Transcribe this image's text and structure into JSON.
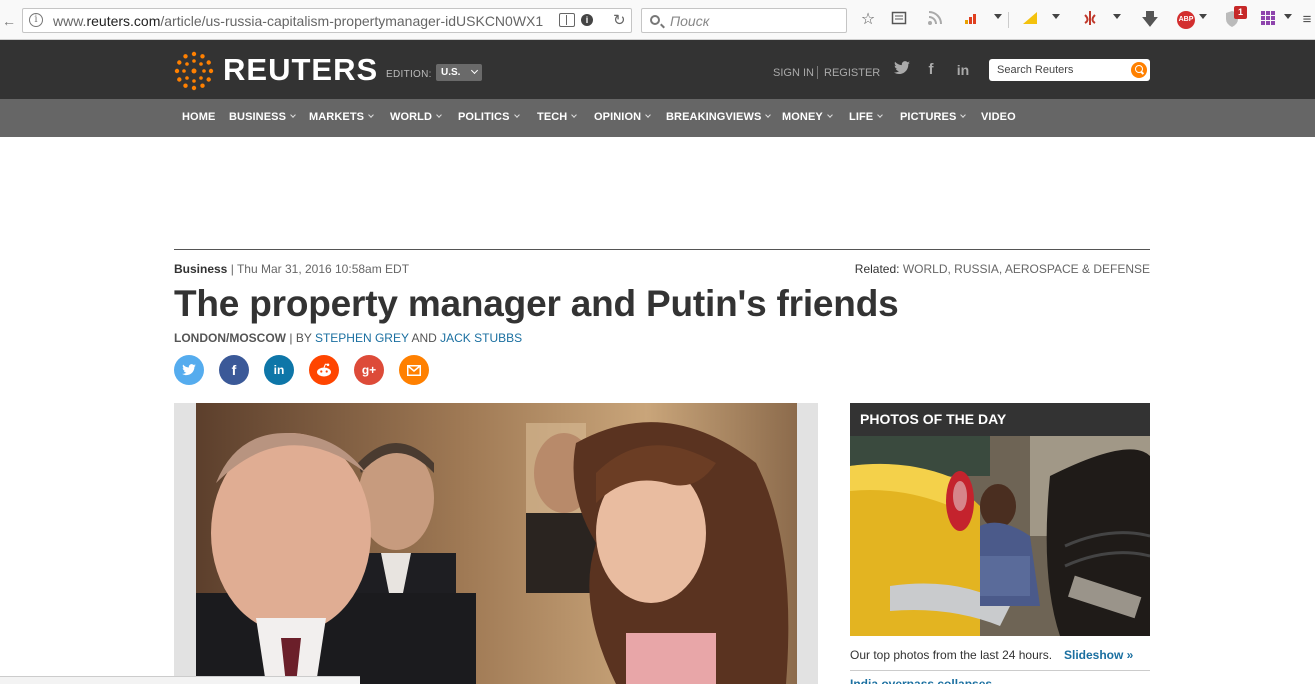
{
  "browser": {
    "url_prefix": "www.",
    "url_domain": "reuters.com",
    "url_path": "/article/us-russia-capitalism-propertymanager-idUSKCN0WX1",
    "search_placeholder": "Поиск",
    "icons": [
      "back-arrow-icon",
      "info-icon",
      "reader-view-icon",
      "reload-icon",
      "search-icon",
      "bookmark-star-icon",
      "reading-list-icon",
      "rss-icon",
      "stats-icon",
      "stats-yellow-icon",
      "rss-red-icon",
      "download-icon",
      "adblock-icon",
      "shield-icon",
      "grid-icon",
      "menu-icon"
    ],
    "adblock_label": "ABP",
    "shield_badge": "1"
  },
  "header": {
    "logo_text": "REUTERS",
    "edition_label": "EDITION:",
    "edition_value": "U.S.",
    "sign_in": "SIGN IN",
    "register": "REGISTER",
    "search_placeholder": "Search Reuters",
    "accent_color": "#ff8000"
  },
  "nav": {
    "items": [
      {
        "label": "HOME"
      },
      {
        "label": "BUSINESS"
      },
      {
        "label": "MARKETS"
      },
      {
        "label": "WORLD"
      },
      {
        "label": "POLITICS"
      },
      {
        "label": "TECH"
      },
      {
        "label": "OPINION"
      },
      {
        "label": "BREAKINGVIEWS"
      },
      {
        "label": "MONEY"
      },
      {
        "label": "LIFE"
      },
      {
        "label": "PICTURES"
      },
      {
        "label": "VIDEO"
      }
    ]
  },
  "article": {
    "section": "Business",
    "separator": "|",
    "timestamp": "Thu Mar 31, 2016 10:58am EDT",
    "related_label": "Related:",
    "related_topics": "WORLD, RUSSIA, AEROSPACE & DEFENSE",
    "headline": "The property manager and Putin's friends",
    "location": "LONDON/MOSCOW",
    "by": "BY",
    "author1": "STEPHEN GREY",
    "and": "AND",
    "author2": "JACK STUBBS",
    "share": [
      {
        "name": "twitter",
        "glyph": "t",
        "color": "#55acee"
      },
      {
        "name": "facebook",
        "glyph": "f",
        "color": "#3b5998"
      },
      {
        "name": "linkedin",
        "glyph": "in",
        "color": "#0e76a8"
      },
      {
        "name": "reddit",
        "glyph": "r",
        "color": "#ff4500"
      },
      {
        "name": "google-plus",
        "glyph": "g+",
        "color": "#dd4b39"
      },
      {
        "name": "email",
        "glyph": "✉",
        "color": "#ff8000"
      }
    ]
  },
  "sidebar": {
    "photos_title": "PHOTOS OF THE DAY",
    "caption": "Our top photos from the last 24 hours.",
    "slideshow_link": "Slideshow  »",
    "next_item": "India overpass collapses"
  }
}
